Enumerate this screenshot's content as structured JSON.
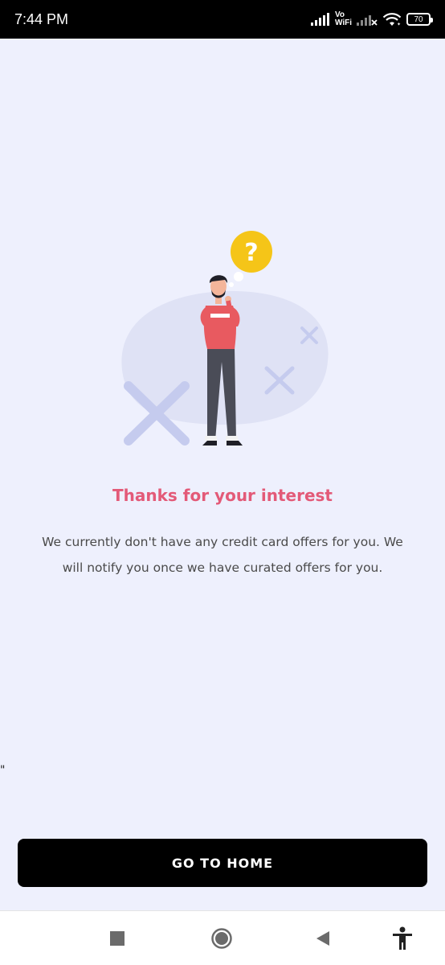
{
  "status_bar": {
    "time": "7:44 PM",
    "network_label": "Vo\nWiFi",
    "battery": "70",
    "icons": [
      "signal-icon",
      "vowifi-icon",
      "signal-no-service-icon",
      "wifi-icon",
      "battery-icon"
    ]
  },
  "empty_state": {
    "illustration": "thinking-man-with-question-bubble",
    "title": "Thanks for your interest",
    "message": "We currently don't have any credit card offers for you. We will notify you once we have curated offers for you."
  },
  "stray_mark": "\"",
  "primary_action": {
    "label": "GO TO HOME"
  },
  "nav_bar": {
    "icons": [
      "recent-apps-icon",
      "home-icon",
      "back-icon",
      "accessibility-icon"
    ]
  },
  "colors": {
    "background": "#eef0fd",
    "title": "#e35a78",
    "button": "#000000",
    "accent_shirt": "#e85a60",
    "accent_bubble": "#f5c518",
    "blob": "#dfe2f5",
    "cross": "#c5cbee"
  }
}
